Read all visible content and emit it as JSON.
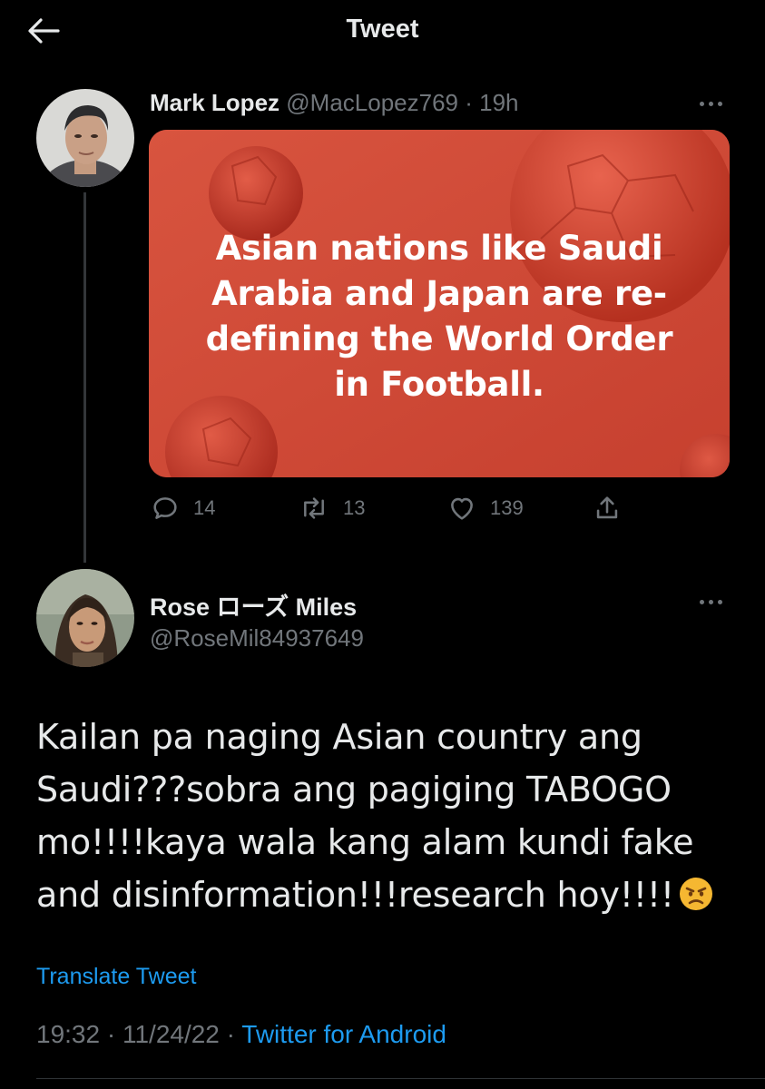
{
  "header": {
    "title": "Tweet"
  },
  "original_tweet": {
    "display_name": "Mark Lopez",
    "handle": "@MacLopez769",
    "separator": " · ",
    "time": "19h",
    "media_text": "Asian nations like Saudi Arabia and Japan are re-defining the World Order in Football.",
    "media_text_lines": [
      "Asian nations like Saudi",
      "Arabia and Japan are re-",
      "defining the World Order",
      "in Football."
    ],
    "stats": {
      "replies": "14",
      "retweets": "13",
      "likes": "139"
    }
  },
  "reply_tweet": {
    "display_name": "Rose ローズ Miles",
    "handle": "@RoseMil84937649",
    "text": "Kailan pa naging Asian country ang Saudi???sobra ang pagiging TABOGO mo!!!!kaya wala kang alam kundi fake and disinformation!!!research hoy!!!!",
    "emoji": "angry-face",
    "translate_label": "Translate Tweet",
    "time": "19:32",
    "date": "11/24/22",
    "separator": " · ",
    "source": "Twitter for Android"
  },
  "colors": {
    "background": "#000000",
    "text": "#e7e9ea",
    "secondary": "#71767b",
    "link": "#1d9bf0",
    "media_red": "#cf4a3a"
  },
  "icons": [
    "back-arrow-icon",
    "more-icon",
    "reply-icon",
    "retweet-icon",
    "like-icon",
    "share-icon"
  ]
}
